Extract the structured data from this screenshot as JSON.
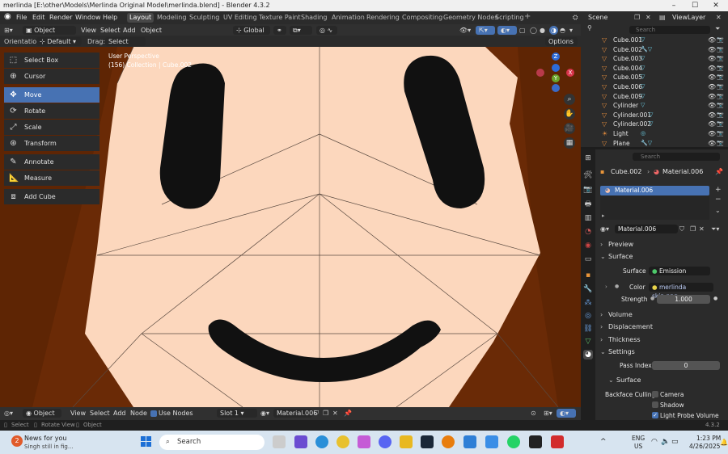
{
  "window": {
    "title": "merlinda [E:\\other\\Models\\Merlinda Original Model\\merlinda.blend] - Blender 4.3.2"
  },
  "menu": {
    "items": [
      "File",
      "Edit",
      "Render",
      "Window",
      "Help"
    ],
    "workspaces": [
      "Layout",
      "Modeling",
      "Sculpting",
      "UV Editing",
      "Texture Paint",
      "Shading",
      "Animation",
      "Rendering",
      "Compositing",
      "Geometry Nodes",
      "Scripting"
    ],
    "active_workspace": "Layout",
    "scene": "Scene",
    "view_layer": "ViewLayer"
  },
  "viewport_header": {
    "mode": "Object Mode",
    "menus": [
      "View",
      "Select",
      "Add",
      "Object"
    ],
    "transform_orientation": "Global",
    "orientation_label": "Orientation:",
    "orientation_value": "Default",
    "drag_label": "Drag:",
    "drag_value": "Select Box",
    "options": "Options"
  },
  "viewport": {
    "perspective": "User Perspective",
    "collection": "(156) Collection | Cube.002"
  },
  "toolbar": {
    "tools": [
      "Select Box",
      "Cursor",
      "Move",
      "Rotate",
      "Scale",
      "Transform",
      "Annotate",
      "Measure",
      "Add Cube"
    ],
    "active": "Move"
  },
  "outliner": {
    "search_placeholder": "Search",
    "items": [
      {
        "name": "Cube.001",
        "icon": "mesh-icon",
        "mods": "▽"
      },
      {
        "name": "Cube.002",
        "icon": "mesh-icon",
        "mods": "🔧▽"
      },
      {
        "name": "Cube.003",
        "icon": "mesh-icon",
        "mods": "▽"
      },
      {
        "name": "Cube.004",
        "icon": "mesh-icon",
        "mods": "▽"
      },
      {
        "name": "Cube.005",
        "icon": "mesh-icon",
        "mods": "▽"
      },
      {
        "name": "Cube.006",
        "icon": "mesh-icon",
        "mods": "▽"
      },
      {
        "name": "Cube.009",
        "icon": "mesh-icon",
        "mods": "▽"
      },
      {
        "name": "Cylinder",
        "icon": "mesh-icon",
        "mods": "▽"
      },
      {
        "name": "Cylinder.001",
        "icon": "mesh-icon",
        "mods": "▽"
      },
      {
        "name": "Cylinder.002",
        "icon": "mesh-icon",
        "mods": "▽"
      },
      {
        "name": "Light",
        "icon": "light-icon",
        "mods": "◎"
      },
      {
        "name": "Plane",
        "icon": "mesh-icon",
        "mods": "🔧▽"
      }
    ]
  },
  "properties": {
    "search_placeholder": "Search",
    "object": "Cube.002",
    "material_breadcrumb": "Material.006",
    "slot_material": "Material.006",
    "material_name": "Material.006",
    "sections": {
      "preview": "Preview",
      "surface": "Surface",
      "volume": "Volume",
      "displacement": "Displacement",
      "thickness": "Thickness",
      "settings": "Settings",
      "surface_sub": "Surface"
    },
    "surface_label": "Surface",
    "surface_value": "Emission",
    "color_label": "Color",
    "color_value": "merlinda skin.png...",
    "strength_label": "Strength",
    "strength_value": "1.000",
    "pass_index_label": "Pass Index",
    "pass_index_value": "0",
    "backface_label": "Backface Culling",
    "camera_label": "Camera",
    "shadow_label": "Shadow",
    "light_probe_label": "Light Probe Volume",
    "light_probe_checked": true
  },
  "bottom_header": {
    "mode": "Object",
    "menus": [
      "View",
      "Select",
      "Add",
      "Node"
    ],
    "use_nodes": "Use Nodes",
    "slot": "Slot 1",
    "material": "Material.006"
  },
  "statusbar": {
    "select": "Select",
    "rotate": "Rotate View",
    "object": "Object",
    "version": "4.3.2"
  },
  "taskbar": {
    "news_title": "News for you",
    "news_sub": "Singh still in fig...",
    "news_badge": "2",
    "search": "Search",
    "lang1": "ENG",
    "lang2": "US",
    "time": "1:23 PM",
    "date": "4/26/2025"
  },
  "colors": {
    "accent": "#4772b3",
    "hair": "#6a2a06",
    "skin": "#fcd7bd"
  }
}
